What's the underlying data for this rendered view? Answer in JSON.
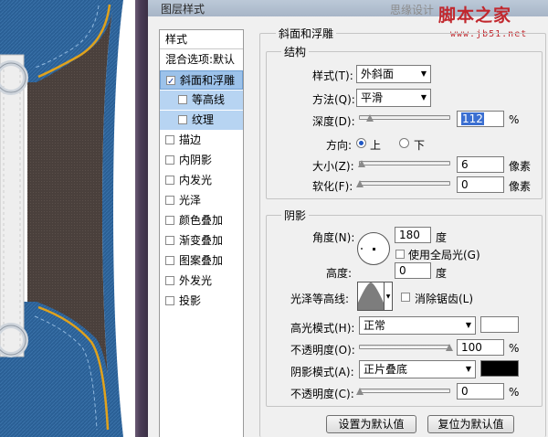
{
  "dialog": {
    "title": "图层样式",
    "watermark": "思缘设计",
    "logo_text": "脚本之家",
    "logo_url": "www.jb51.net"
  },
  "styles_list": {
    "header": "样式",
    "items": [
      {
        "label": "混合选项:默认",
        "checkbox": false,
        "checked": false,
        "state": "normal"
      },
      {
        "label": "斜面和浮雕",
        "checkbox": true,
        "checked": true,
        "state": "selected"
      },
      {
        "label": "等高线",
        "checkbox": true,
        "checked": false,
        "state": "sub"
      },
      {
        "label": "纹理",
        "checkbox": true,
        "checked": false,
        "state": "sub"
      },
      {
        "label": "描边",
        "checkbox": true,
        "checked": false,
        "state": "normal"
      },
      {
        "label": "内阴影",
        "checkbox": true,
        "checked": false,
        "state": "normal"
      },
      {
        "label": "内发光",
        "checkbox": true,
        "checked": false,
        "state": "normal"
      },
      {
        "label": "光泽",
        "checkbox": true,
        "checked": false,
        "state": "normal"
      },
      {
        "label": "颜色叠加",
        "checkbox": true,
        "checked": false,
        "state": "normal"
      },
      {
        "label": "渐变叠加",
        "checkbox": true,
        "checked": false,
        "state": "normal"
      },
      {
        "label": "图案叠加",
        "checkbox": true,
        "checked": false,
        "state": "normal"
      },
      {
        "label": "外发光",
        "checkbox": true,
        "checked": false,
        "state": "normal"
      },
      {
        "label": "投影",
        "checkbox": true,
        "checked": false,
        "state": "normal"
      }
    ]
  },
  "bevel": {
    "title": "斜面和浮雕",
    "structure": {
      "title": "结构",
      "style_label": "样式(T):",
      "style_value": "外斜面",
      "technique_label": "方法(Q):",
      "technique_value": "平滑",
      "depth_label": "深度(D):",
      "depth_value": "112",
      "depth_unit": "%",
      "depth_fraction": 0.11,
      "direction_label": "方向:",
      "direction_up": "上",
      "direction_down": "下",
      "direction_selected": "上",
      "size_label": "大小(Z):",
      "size_value": "6",
      "size_unit": "像素",
      "size_fraction": 0.02,
      "soften_label": "软化(F):",
      "soften_value": "0",
      "soften_unit": "像素",
      "soften_fraction": 0.0
    },
    "shading": {
      "title": "阴影",
      "angle_label": "角度(N):",
      "angle_value": "180",
      "angle_unit": "度",
      "global_light_label": "使用全局光(G)",
      "global_light_checked": false,
      "altitude_label": "高度:",
      "altitude_value": "0",
      "altitude_unit": "度",
      "gloss_contour_label": "光泽等高线:",
      "anti_alias_label": "消除锯齿(L)",
      "anti_alias_checked": false,
      "highlight_mode_label": "高光模式(H):",
      "highlight_mode_value": "正常",
      "highlight_color": "#ffffff",
      "highlight_opacity_label": "不透明度(O):",
      "highlight_opacity_value": "100",
      "highlight_opacity_unit": "%",
      "highlight_opacity_fraction": 1.0,
      "shadow_mode_label": "阴影模式(A):",
      "shadow_mode_value": "正片叠底",
      "shadow_color": "#000000",
      "shadow_opacity_label": "不透明度(C):",
      "shadow_opacity_value": "0",
      "shadow_opacity_unit": "%",
      "shadow_opacity_fraction": 0.0
    },
    "buttons": {
      "make_default": "设置为默认值",
      "reset_default": "复位为默认值"
    }
  },
  "colors": {
    "list_selected": "#9cc2ea",
    "list_sub": "#b7d4f2",
    "denim": "#2a5f95",
    "leather": "#4a403c",
    "stitch_gold": "#e0a21c"
  }
}
